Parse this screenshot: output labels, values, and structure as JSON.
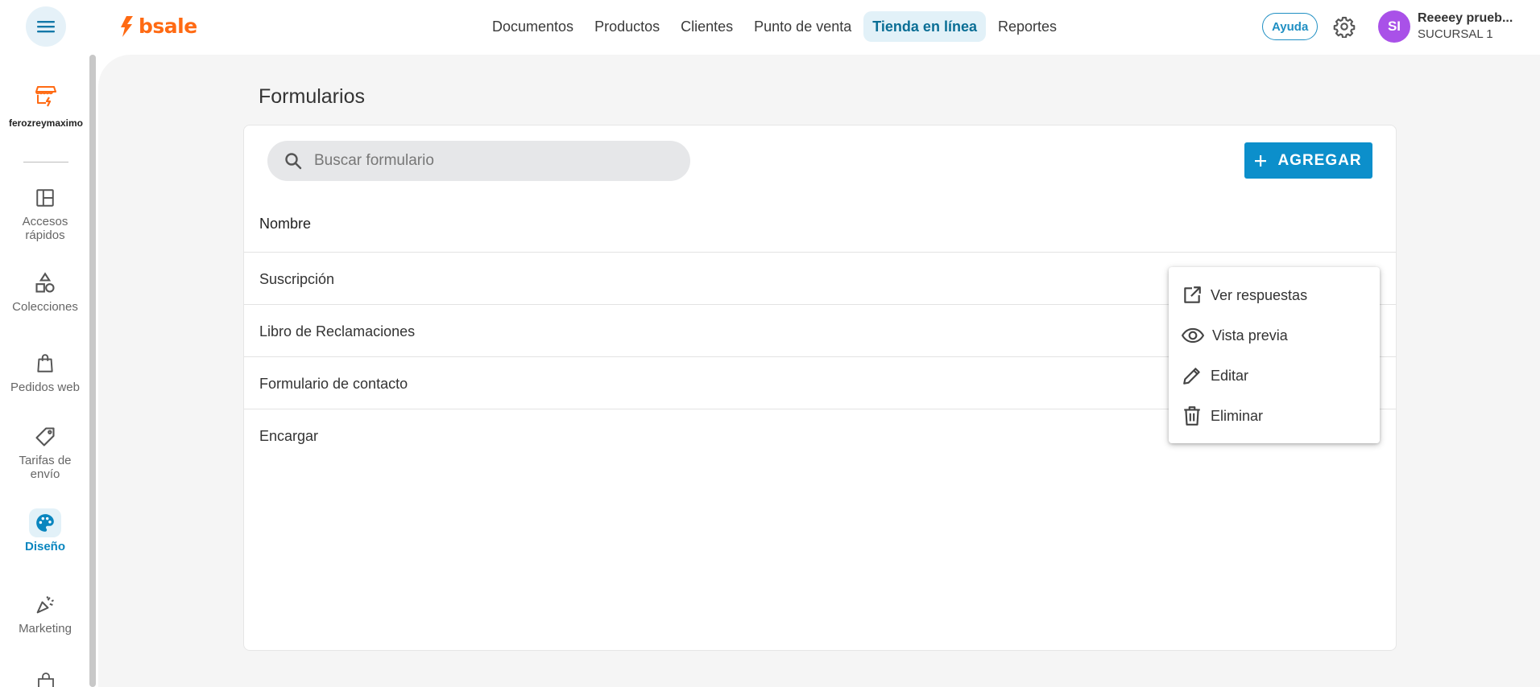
{
  "app": {
    "logo_text": "bsale",
    "brand_color": "#ff6a13",
    "accent_color": "#0c8fcb"
  },
  "topnav": {
    "items": [
      {
        "label": "Documentos",
        "active": false
      },
      {
        "label": "Productos",
        "active": false
      },
      {
        "label": "Clientes",
        "active": false
      },
      {
        "label": "Punto de venta",
        "active": false
      },
      {
        "label": "Tienda en línea",
        "active": true
      },
      {
        "label": "Reportes",
        "active": false
      }
    ],
    "help_label": "Ayuda",
    "settings_icon": "gear-icon"
  },
  "user": {
    "initials": "SI",
    "name": "Reeeey prueb...",
    "branch": "SUCURSAL 1",
    "avatar_color": "#a951e8"
  },
  "sidebar": {
    "store_name": "ferozreymaximo",
    "items": [
      {
        "label": "Accesos rápidos",
        "icon": "dashboard-icon",
        "active": false
      },
      {
        "label": "Colecciones",
        "icon": "shapes-icon",
        "active": false
      },
      {
        "label": "Pedidos web",
        "icon": "bag-icon",
        "active": false
      },
      {
        "label": "Tarifas de envío",
        "icon": "tag-icon",
        "active": false
      },
      {
        "label": "Diseño",
        "icon": "palette-icon",
        "active": true
      },
      {
        "label": "Marketing",
        "icon": "megaphone-icon",
        "active": false
      }
    ]
  },
  "page": {
    "title": "Formularios",
    "search_placeholder": "Buscar formulario",
    "add_label": "AGREGAR",
    "column_header": "Nombre",
    "rows": [
      {
        "name": "Suscripción"
      },
      {
        "name": "Libro de Reclamaciones"
      },
      {
        "name": "Formulario de contacto"
      },
      {
        "name": "Encargar"
      }
    ]
  },
  "context_menu": {
    "items": [
      {
        "label": "Ver respuestas",
        "icon": "open-external-icon"
      },
      {
        "label": "Vista previa",
        "icon": "eye-icon"
      },
      {
        "label": "Editar",
        "icon": "pencil-icon"
      },
      {
        "label": "Eliminar",
        "icon": "trash-icon"
      }
    ]
  }
}
